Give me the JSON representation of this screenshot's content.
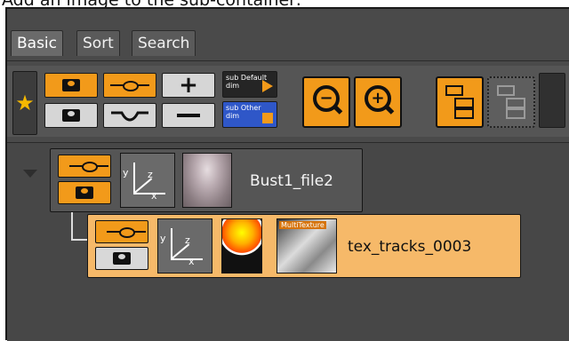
{
  "caption": "Add an image to the sub-container:",
  "tabs": [
    {
      "label": "Basic"
    },
    {
      "label": "Sort"
    },
    {
      "label": "Search"
    }
  ],
  "toolbar": {
    "sub_default_tile": "sub Default dim",
    "sub_other_tile": "sub Other dim"
  },
  "tree": {
    "parent": {
      "name": "Bust1_file2",
      "axis_x": "x",
      "axis_y": "y",
      "axis_z": "z"
    },
    "child": {
      "name": "tex_tracks_0003",
      "multitexture_label": "MultiTexture",
      "axis_x": "x",
      "axis_y": "y",
      "axis_z": "z"
    }
  },
  "colors": {
    "accent_orange": "#f29a1a",
    "panel_bg": "#4a4a4a",
    "selected_node": "#f6b969",
    "star": "#f5b800"
  }
}
